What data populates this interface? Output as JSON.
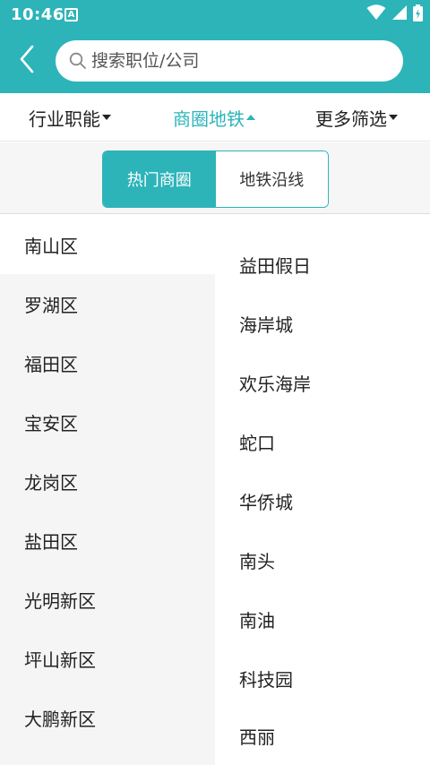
{
  "colors": {
    "accent": "#2db4b9",
    "background": "#ffffff",
    "panel": "#f5f5f5"
  },
  "status_bar": {
    "time": "10:46",
    "notification_icon_label": "A",
    "icons": [
      "wifi-icon",
      "signal-icon",
      "battery-icon"
    ]
  },
  "search": {
    "placeholder": "搜索职位/公司",
    "value": ""
  },
  "filters": [
    {
      "label": "行业职能",
      "active": false,
      "caret": "down"
    },
    {
      "label": "商圈地铁",
      "active": true,
      "caret": "up"
    },
    {
      "label": "更多筛选",
      "active": false,
      "caret": "down"
    }
  ],
  "segmented_tabs": [
    {
      "label": "热门商圈",
      "selected": true
    },
    {
      "label": "地铁沿线",
      "selected": false
    }
  ],
  "districts": {
    "selected_index": 0,
    "items": [
      "南山区",
      "罗湖区",
      "福田区",
      "宝安区",
      "龙岗区",
      "盐田区",
      "光明新区",
      "坪山新区",
      "大鹏新区"
    ]
  },
  "areas": {
    "items": [
      "益田假日",
      "海岸城",
      "欢乐海岸",
      "蛇口",
      "华侨城",
      "南头",
      "南油",
      "科技园",
      "西丽"
    ]
  }
}
